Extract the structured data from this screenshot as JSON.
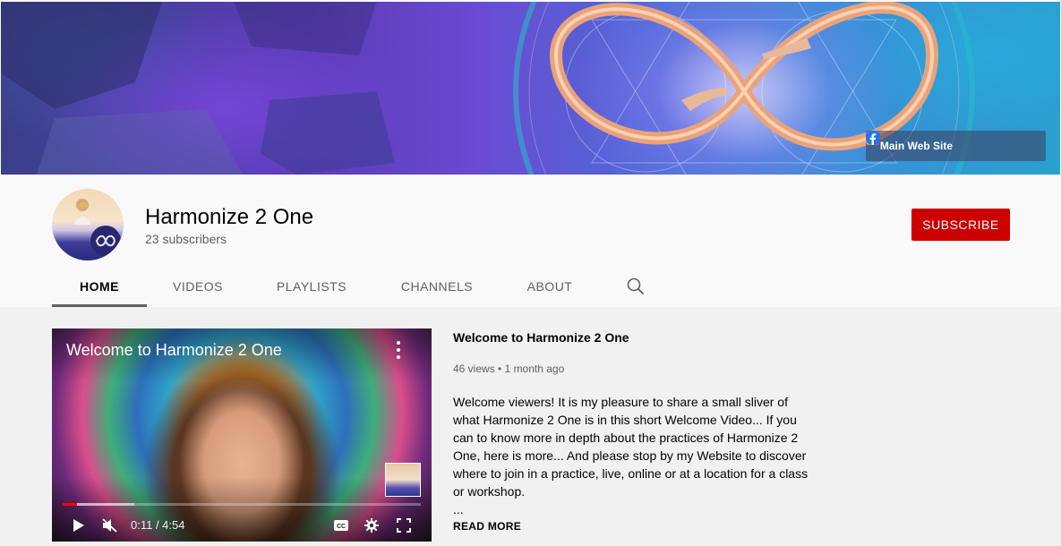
{
  "banner": {
    "link_label": "Main Web Site",
    "social": [
      "instagram-icon",
      "twitter-icon",
      "facebook-icon"
    ]
  },
  "channel": {
    "name": "Harmonize 2 One",
    "subscribers": "23 subscribers",
    "subscribe_label": "SUBSCRIBE"
  },
  "tabs": [
    {
      "label": "HOME",
      "active": true
    },
    {
      "label": "VIDEOS",
      "active": false
    },
    {
      "label": "PLAYLISTS",
      "active": false
    },
    {
      "label": "CHANNELS",
      "active": false
    },
    {
      "label": "ABOUT",
      "active": false
    }
  ],
  "featured": {
    "player_title": "Welcome to Harmonize 2 One",
    "time": "0:11 / 4:54",
    "progress": 0.04,
    "loaded": 0.2,
    "title": "Welcome to Harmonize 2 One",
    "meta": "46 views • 1 month ago",
    "description": "Welcome viewers! It is my pleasure to share a small sliver of what Harmonize 2 One is in this short Welcome Video... If you can to know more in depth about the practices of Harmonize 2 One, here is more... And please stop by my Website to discover where to join in a practice, live, online or at a location for a class or workshop.",
    "ellipsis": "...",
    "read_more": "READ MORE"
  },
  "colors": {
    "subscribe": "#cc0000",
    "progress_played": "#ff0000"
  }
}
